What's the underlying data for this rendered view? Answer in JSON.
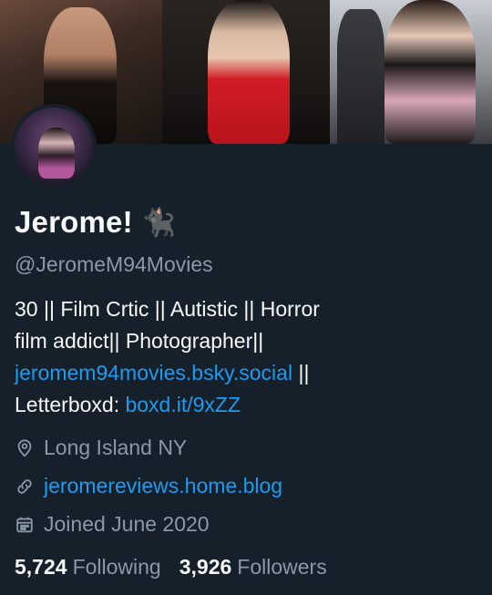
{
  "profile": {
    "name": "Jerome!",
    "name_emoji": "🐈‍⬛",
    "handle": "@JeromeM94Movies",
    "bio": {
      "line1": "30 || Film Crtic || Autistic || Horror",
      "line2": "film addict|| Photographer||",
      "line3_link": "jeromem94movies.bsky.social",
      "line3_suffix": " ||",
      "line4_prefix": "Letterboxd: ",
      "line4_link": "boxd.it/9xZZ"
    },
    "location": "Long Island NY",
    "website": "jeromereviews.home.blog",
    "joined": "Joined June 2020",
    "following_count": "5,724",
    "following_label": "Following",
    "followers_count": "3,926",
    "followers_label": "Followers"
  },
  "icons": {
    "location": "location-pin-icon",
    "website": "link-icon",
    "joined": "calendar-icon"
  },
  "colors": {
    "background": "#15202b",
    "text_primary": "#f7f9f9",
    "text_secondary": "#8b98a5",
    "link": "#1d9bf0"
  }
}
